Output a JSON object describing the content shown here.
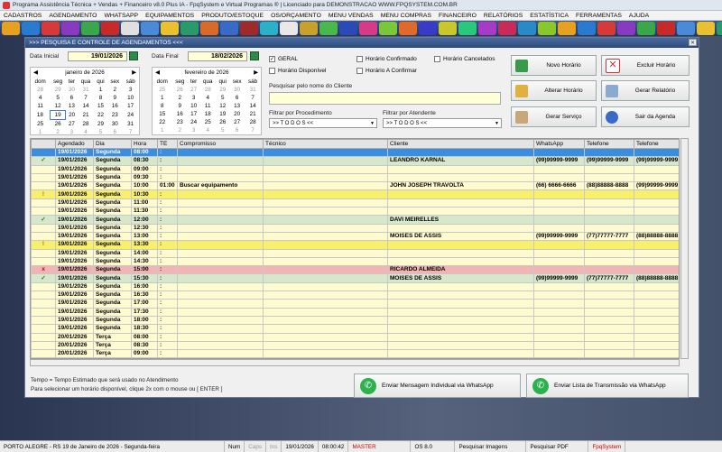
{
  "window_title": "Programa Assistência Técnica + Vendas + Financeiro v8.0 Plus IA - FpqSystem e Virtual Programas ® | Licenciado para DEMONSTRACAO WWW.FPQSYSTEM.COM.BR",
  "menu": [
    "CADASTROS",
    "AGENDAMENTO",
    "WHATSAPP",
    "EQUIPAMENTOS",
    "PRODUTO/ESTOQUE",
    "OS/ORÇAMENTO",
    "MENU VENDAS",
    "MENU COMPRAS",
    "FINANCEIRO",
    "RELATÓRIOS",
    "ESTATÍSTICA",
    "FERRAMENTAS",
    "AJUDA"
  ],
  "toolbar_colors": [
    "#e8a020",
    "#2a7ad0",
    "#d83a3a",
    "#8a3ac0",
    "#3aa84a",
    "#c82a2a",
    "#e0e0e0",
    "#4a8ad8",
    "#e8c030",
    "#2a9a6a",
    "#d86a2a",
    "#3a6ac8",
    "#a02a2a",
    "#2ab0c8",
    "#e8e8e8",
    "#c8a02a",
    "#4ab84a",
    "#2a4ab8",
    "#d83a8a",
    "#7ac83a",
    "#e06a2a",
    "#3a3ac8",
    "#c8c82a",
    "#2ac87a",
    "#a83ac8",
    "#c82a5a",
    "#2a8ac8",
    "#88c82a",
    "#e8a020",
    "#2a7ad0",
    "#d83a3a",
    "#8a3ac0",
    "#3aa84a",
    "#c82a2a",
    "#4a8ad8",
    "#e8c030",
    "#2a9a6a",
    "#d86a2a",
    "#3a6ac8"
  ],
  "form_title": ">>> PESQUISA E CONTROLE DE AGENDAMENTOS <<<",
  "data_inicial": {
    "label": "Data Inicial",
    "value": "19/01/2026"
  },
  "data_final": {
    "label": "Data Final",
    "value": "18/02/2026"
  },
  "cal1": {
    "month": "janeiro de 2026",
    "days": [
      "dom",
      "seg",
      "ter",
      "qua",
      "qui",
      "sex",
      "sáb"
    ],
    "weeks": [
      [
        "28",
        "29",
        "30",
        "31",
        "1",
        "2",
        "3"
      ],
      [
        "4",
        "5",
        "6",
        "7",
        "8",
        "9",
        "10"
      ],
      [
        "11",
        "12",
        "13",
        "14",
        "15",
        "16",
        "17"
      ],
      [
        "18",
        "19",
        "20",
        "21",
        "22",
        "23",
        "24"
      ],
      [
        "25",
        "26",
        "27",
        "28",
        "29",
        "30",
        "31"
      ],
      [
        "1",
        "2",
        "3",
        "4",
        "5",
        "6",
        "7"
      ]
    ]
  },
  "cal2": {
    "month": "fevereiro de 2026",
    "days": [
      "dom",
      "seg",
      "ter",
      "qua",
      "qui",
      "sex",
      "sáb"
    ],
    "weeks": [
      [
        "25",
        "26",
        "27",
        "28",
        "29",
        "30",
        "31"
      ],
      [
        "1",
        "2",
        "3",
        "4",
        "5",
        "6",
        "7"
      ],
      [
        "8",
        "9",
        "10",
        "11",
        "12",
        "13",
        "14"
      ],
      [
        "15",
        "16",
        "17",
        "18",
        "19",
        "20",
        "21"
      ],
      [
        "22",
        "23",
        "24",
        "25",
        "26",
        "27",
        "28"
      ],
      [
        "1",
        "2",
        "3",
        "4",
        "5",
        "6",
        "7"
      ]
    ]
  },
  "filters": {
    "geral": "GERAL",
    "disponivel": "Horário Disponível",
    "confirmado": "Horário Confirmado",
    "a_confirmar": "Horário A Confirmar",
    "cancelados": "Horário Cancelados",
    "search_label": "Pesquisar pelo nome do Cliente",
    "proc_label": "Filtrar por Procedimento",
    "proc_value": ">> T O D O S <<",
    "atend_label": "Filtrar por Atendente",
    "atend_value": ">> T O D O S <<"
  },
  "buttons": {
    "novo": "Novo Horário",
    "excluir": "Excluir Horário",
    "alterar": "Alterar Horário",
    "relatorio": "Gerar Relatório",
    "servico": "Gerar  Serviço",
    "sair": "Sair da Agenda"
  },
  "grid": {
    "columns": [
      "",
      "Agendado",
      "Dia",
      "Hora",
      "TE",
      "Compromisso",
      "Técnico",
      "Cliente",
      "WhatsApp",
      "Telefone",
      "Telefone"
    ],
    "rows": [
      {
        "s": "sel",
        "m": "",
        "d": "19/01/2026",
        "w": "Segunda",
        "h": "08:00",
        "te": ":",
        "c": "",
        "t": "",
        "cl": "",
        "wa": "",
        "t1": "",
        "t2": ""
      },
      {
        "s": "green",
        "m": "✓",
        "d": "19/01/2026",
        "w": "Segunda",
        "h": "08:30",
        "te": ":",
        "c": "",
        "t": "",
        "cl": "LEANDRO KARNAL",
        "wa": "(99)99999-9999",
        "t1": "(99)99999-9999",
        "t2": "(99)99999-9999"
      },
      {
        "s": "yellow",
        "m": "",
        "d": "19/01/2026",
        "w": "Segunda",
        "h": "09:00",
        "te": ":",
        "c": "",
        "t": "",
        "cl": "",
        "wa": "",
        "t1": "",
        "t2": ""
      },
      {
        "s": "yellow",
        "m": "",
        "d": "19/01/2026",
        "w": "Segunda",
        "h": "09:30",
        "te": ":",
        "c": "",
        "t": "",
        "cl": "",
        "wa": "",
        "t1": "",
        "t2": ""
      },
      {
        "s": "yellow",
        "m": "",
        "d": "19/01/2026",
        "w": "Segunda",
        "h": "10:00",
        "te": "01:00",
        "c": "Buscar equipamento",
        "t": "",
        "cl": "JOHN JOSEPH TRAVOLTA",
        "wa": "(66) 6666-6666",
        "t1": "(88)88888-8888",
        "t2": "(99)99999-9999"
      },
      {
        "s": "bright",
        "m": "!",
        "d": "19/01/2026",
        "w": "Segunda",
        "h": "10:30",
        "te": ":",
        "c": "",
        "t": "",
        "cl": "",
        "wa": "",
        "t1": "",
        "t2": ""
      },
      {
        "s": "yellow",
        "m": "",
        "d": "19/01/2026",
        "w": "Segunda",
        "h": "11:00",
        "te": ":",
        "c": "",
        "t": "",
        "cl": "",
        "wa": "",
        "t1": "",
        "t2": ""
      },
      {
        "s": "yellow",
        "m": "",
        "d": "19/01/2026",
        "w": "Segunda",
        "h": "11:30",
        "te": ":",
        "c": "",
        "t": "",
        "cl": "",
        "wa": "",
        "t1": "",
        "t2": ""
      },
      {
        "s": "green",
        "m": "✓",
        "d": "19/01/2026",
        "w": "Segunda",
        "h": "12:00",
        "te": ":",
        "c": "",
        "t": "",
        "cl": "DAVI MEIRELLES",
        "wa": "",
        "t1": "",
        "t2": ""
      },
      {
        "s": "yellow",
        "m": "",
        "d": "19/01/2026",
        "w": "Segunda",
        "h": "12:30",
        "te": ":",
        "c": "",
        "t": "",
        "cl": "",
        "wa": "",
        "t1": "",
        "t2": ""
      },
      {
        "s": "yellow",
        "m": "",
        "d": "19/01/2026",
        "w": "Segunda",
        "h": "13:00",
        "te": ":",
        "c": "",
        "t": "",
        "cl": "MOISES DE ASSIS",
        "wa": "(99)99999-9999",
        "t1": "(77)77777-7777",
        "t2": "(88)88888-8888"
      },
      {
        "s": "bright",
        "m": "!",
        "d": "19/01/2026",
        "w": "Segunda",
        "h": "13:30",
        "te": ":",
        "c": "",
        "t": "",
        "cl": "",
        "wa": "",
        "t1": "",
        "t2": ""
      },
      {
        "s": "yellow",
        "m": "",
        "d": "19/01/2026",
        "w": "Segunda",
        "h": "14:00",
        "te": ":",
        "c": "",
        "t": "",
        "cl": "",
        "wa": "",
        "t1": "",
        "t2": ""
      },
      {
        "s": "yellow",
        "m": "",
        "d": "19/01/2026",
        "w": "Segunda",
        "h": "14:30",
        "te": ":",
        "c": "",
        "t": "",
        "cl": "",
        "wa": "",
        "t1": "",
        "t2": ""
      },
      {
        "s": "red",
        "m": "x",
        "d": "19/01/2026",
        "w": "Segunda",
        "h": "15:00",
        "te": ":",
        "c": "",
        "t": "",
        "cl": "RICARDO ALMEIDA",
        "wa": "",
        "t1": "",
        "t2": ""
      },
      {
        "s": "green",
        "m": "✓",
        "d": "19/01/2026",
        "w": "Segunda",
        "h": "15:30",
        "te": ":",
        "c": "",
        "t": "",
        "cl": "MOISES DE ASSIS",
        "wa": "(99)99999-9999",
        "t1": "(77)77777-7777",
        "t2": "(88)88888-8888"
      },
      {
        "s": "yellow",
        "m": "",
        "d": "19/01/2026",
        "w": "Segunda",
        "h": "16:00",
        "te": ":",
        "c": "",
        "t": "",
        "cl": "",
        "wa": "",
        "t1": "",
        "t2": ""
      },
      {
        "s": "yellow",
        "m": "",
        "d": "19/01/2026",
        "w": "Segunda",
        "h": "16:30",
        "te": ":",
        "c": "",
        "t": "",
        "cl": "",
        "wa": "",
        "t1": "",
        "t2": ""
      },
      {
        "s": "yellow",
        "m": "",
        "d": "19/01/2026",
        "w": "Segunda",
        "h": "17:00",
        "te": ":",
        "c": "",
        "t": "",
        "cl": "",
        "wa": "",
        "t1": "",
        "t2": ""
      },
      {
        "s": "yellow",
        "m": "",
        "d": "19/01/2026",
        "w": "Segunda",
        "h": "17:30",
        "te": ":",
        "c": "",
        "t": "",
        "cl": "",
        "wa": "",
        "t1": "",
        "t2": ""
      },
      {
        "s": "yellow",
        "m": "",
        "d": "19/01/2026",
        "w": "Segunda",
        "h": "18:00",
        "te": ":",
        "c": "",
        "t": "",
        "cl": "",
        "wa": "",
        "t1": "",
        "t2": ""
      },
      {
        "s": "yellow",
        "m": "",
        "d": "19/01/2026",
        "w": "Segunda",
        "h": "18:30",
        "te": ":",
        "c": "",
        "t": "",
        "cl": "",
        "wa": "",
        "t1": "",
        "t2": ""
      },
      {
        "s": "yellow",
        "m": "",
        "d": "20/01/2026",
        "w": "Terça",
        "h": "08:00",
        "te": ":",
        "c": "",
        "t": "",
        "cl": "",
        "wa": "",
        "t1": "",
        "t2": ""
      },
      {
        "s": "yellow",
        "m": "",
        "d": "20/01/2026",
        "w": "Terça",
        "h": "08:30",
        "te": ":",
        "c": "",
        "t": "",
        "cl": "",
        "wa": "",
        "t1": "",
        "t2": ""
      },
      {
        "s": "yellow",
        "m": "",
        "d": "20/01/2026",
        "w": "Terça",
        "h": "09:00",
        "te": ":",
        "c": "",
        "t": "",
        "cl": "",
        "wa": "",
        "t1": "",
        "t2": ""
      }
    ]
  },
  "notes": {
    "tempo": "Tempo = Tempo Estimado que será usado no Atendimento",
    "hint": "Para selecionar um horário disponível, clique 2x com o mouse ou [ ENTER ]"
  },
  "wa_buttons": {
    "individual": "Enviar Mensagem Individual via WhatsApp",
    "lista": "Enviar Lista de Transmissão via WhatsApp"
  },
  "status": {
    "location": "PORTO ALEGRE - RS 19 de Janeiro de 2026 - Segunda-feira",
    "num": "Num",
    "caps": "Caps",
    "ins": "Ins",
    "date": "19/01/2026",
    "time": "08:00:42",
    "master": "MASTER",
    "os": "OS 8.0",
    "imagens": "Pesquisar Imagens",
    "pdf": "Pesquisar PDF",
    "brand": "FpqSystem"
  }
}
